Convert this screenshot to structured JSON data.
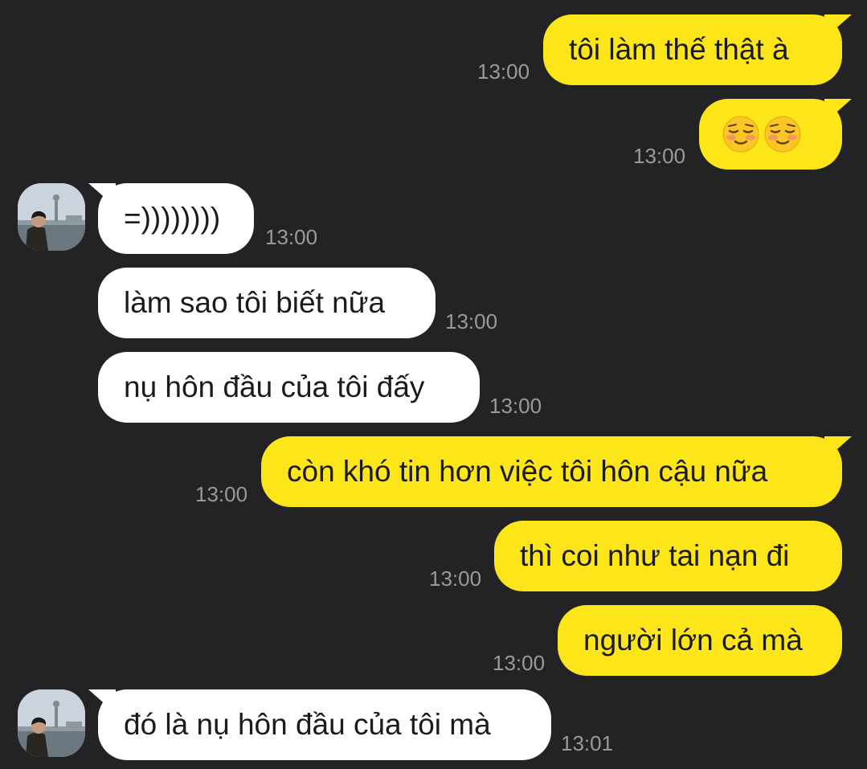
{
  "conversation": {
    "messages": [
      {
        "id": "m1",
        "side": "out",
        "text": "tôi làm thế thật à",
        "time": "13:00"
      },
      {
        "id": "m2",
        "side": "out",
        "text": "",
        "emojis": [
          "smiling-blush-emoji",
          "smiling-blush-emoji"
        ],
        "time": "13:00"
      },
      {
        "id": "m3",
        "side": "in",
        "text": "=))))))))",
        "time": "13:00",
        "avatar": "profile-photo"
      },
      {
        "id": "m4",
        "side": "in",
        "text": "làm sao tôi biết nữa",
        "time": "13:00"
      },
      {
        "id": "m5",
        "side": "in",
        "text": "nụ hôn đầu của tôi đấy",
        "time": "13:00"
      },
      {
        "id": "m6",
        "side": "out",
        "text": "còn khó tin hơn việc tôi hôn cậu nữa",
        "time": "13:00"
      },
      {
        "id": "m7",
        "side": "out",
        "text": "thì coi như tai nạn đi",
        "time": "13:00"
      },
      {
        "id": "m8",
        "side": "out",
        "text": "người lớn cả mà",
        "time": "13:00"
      },
      {
        "id": "m9",
        "side": "in",
        "text": "đó là nụ hôn đầu của tôi mà",
        "time": "13:01",
        "avatar": "profile-photo"
      }
    ]
  },
  "colors": {
    "background": "#232326",
    "outgoing_bubble": "#fce518",
    "incoming_bubble": "#ffffff",
    "timestamp": "#9a9a9c"
  }
}
